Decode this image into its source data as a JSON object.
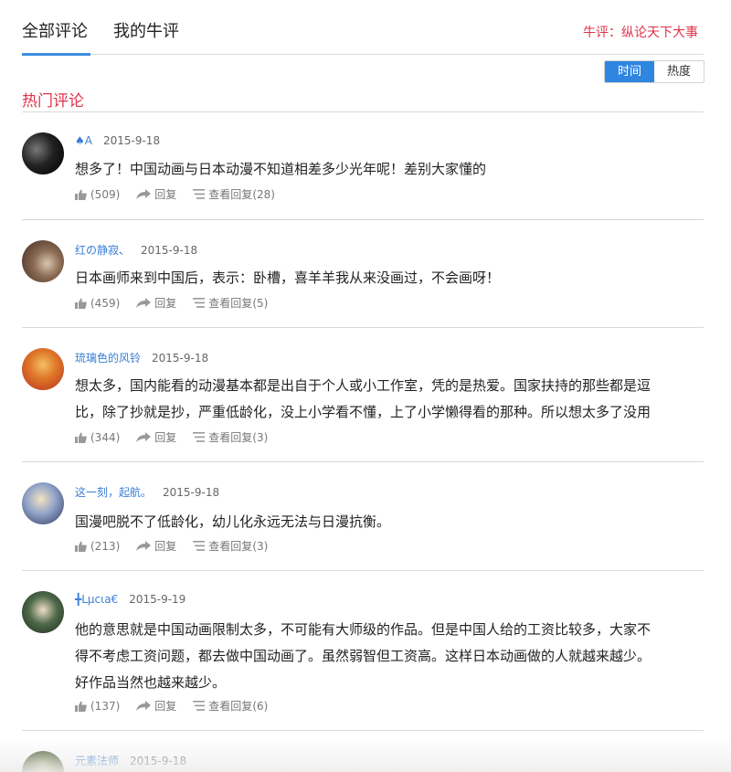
{
  "tabs": [
    {
      "label": "全部评论"
    },
    {
      "label": "我的牛评"
    }
  ],
  "promo": "牛评：纵论天下大事",
  "sort": {
    "time": "时间",
    "hot": "热度"
  },
  "section_title": "热门评论",
  "labels": {
    "reply": "回复",
    "view_replies": "查看回复"
  },
  "comments": [
    {
      "user": "♠A",
      "date": "2015-9-18",
      "lines": [
        "想多了！中国动画与日本动漫不知道相差多少光年呢！差别大家懂的"
      ],
      "likes": "(509)",
      "replies": "(28)"
    },
    {
      "user": "红の静寂、",
      "date": "2015-9-18",
      "lines": [
        "日本画师来到中国后，表示：卧槽，喜羊羊我从来没画过，不会画呀！"
      ],
      "likes": "(459)",
      "replies": "(5)"
    },
    {
      "user": "琉璃色的风铃",
      "date": "2015-9-18",
      "lines": [
        "想太多，国内能看的动漫基本都是出自于个人或小工作室，凭的是热爱。国家扶持的那些都是逗",
        "比，除了抄就是抄，严重低龄化，没上小学看不懂，上了小学懒得看的那种。所以想太多了没用"
      ],
      "likes": "(344)",
      "replies": "(3)"
    },
    {
      "user": "这一刻，起航。",
      "date": "2015-9-18",
      "lines": [
        "国漫吧脱不了低龄化，幼儿化永远无法与日漫抗衡。"
      ],
      "likes": "(213)",
      "replies": "(3)"
    },
    {
      "user": "╋Lμcιa€",
      "date": "2015-9-19",
      "lines": [
        "他的意思就是中国动画限制太多，不可能有大师级的作品。但是中国人给的工资比较多，大家不",
        "得不考虑工资问题，都去做中国动画了。虽然弱智但工资高。这样日本动画做的人就越来越少。",
        "好作品当然也越来越少。"
      ],
      "likes": "(137)",
      "replies": "(6)"
    },
    {
      "user": "元素法师",
      "date": "2015-9-18",
      "lines": [],
      "likes": "",
      "replies": ""
    }
  ]
}
